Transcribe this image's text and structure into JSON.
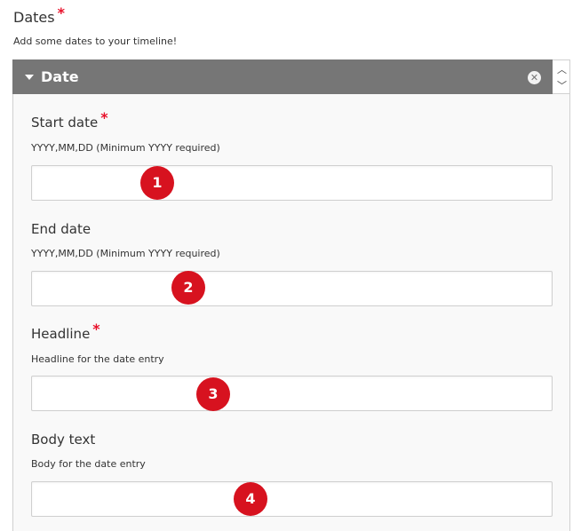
{
  "section": {
    "title": "Dates",
    "required_marker": "*",
    "description": "Add some dates to your timeline!"
  },
  "group": {
    "title": "Date",
    "remove_icon": "x",
    "move_up_icon": "^",
    "move_down_icon": "v"
  },
  "fields": [
    {
      "label": "Start date",
      "required": true,
      "required_marker": "*",
      "description": "YYYY,MM,DD (Minimum YYYY required)",
      "value": "",
      "badge": "1"
    },
    {
      "label": "End date",
      "required": false,
      "description": "YYYY,MM,DD (Minimum YYYY required)",
      "value": "",
      "badge": "2"
    },
    {
      "label": "Headline",
      "required": true,
      "required_marker": "*",
      "description": "Headline for the date entry",
      "value": "",
      "badge": "3"
    },
    {
      "label": "Body text",
      "required": false,
      "description": "Body for the date entry",
      "value": "",
      "badge": "4"
    }
  ],
  "colors": {
    "required": "#e8102a",
    "header_bg": "#767676",
    "badge": "#d7121f"
  }
}
